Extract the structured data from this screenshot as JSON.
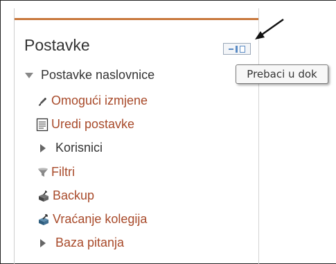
{
  "block": {
    "title": "Postavke",
    "dock_tooltip": "Prebaci u dok",
    "accent_color": "#c8763a",
    "link_color": "#a84a2a"
  },
  "tree": {
    "root_label": "Postavke naslovnice",
    "items": [
      {
        "label": "Omogući izmjene",
        "icon": "pencil-edit-icon"
      },
      {
        "label": "Uredi postavke",
        "icon": "settings-document-icon"
      },
      {
        "label": "Korisnici",
        "icon": "expand-arrow-icon"
      },
      {
        "label": "Filtri",
        "icon": "funnel-filter-icon"
      },
      {
        "label": "Backup",
        "icon": "backup-box-icon"
      },
      {
        "label": "Vraćanje kolegija",
        "icon": "restore-box-icon"
      },
      {
        "label": "Baza pitanja",
        "icon": "expand-arrow-icon"
      }
    ]
  }
}
